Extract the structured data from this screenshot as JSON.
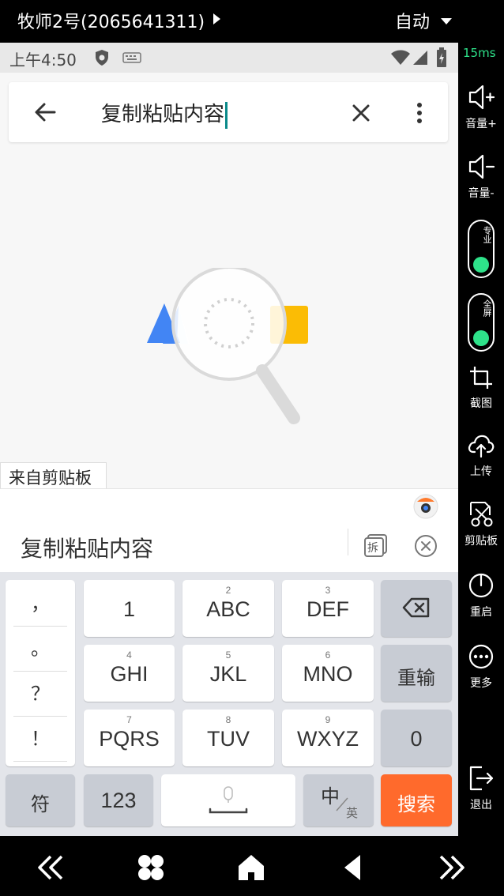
{
  "topbar": {
    "device_name": "牧师2号(2065641311)",
    "mode": "自动"
  },
  "statusbar": {
    "time": "上午4:50"
  },
  "search": {
    "query": "复制粘贴内容"
  },
  "clipboard": {
    "tab_label": "来自剪贴板",
    "content": "复制粘贴内容",
    "split_label": "拆"
  },
  "keyboard": {
    "punctuation": [
      "，",
      "。",
      "？",
      "！"
    ],
    "rows": [
      [
        {
          "main": "1",
          "sub": ""
        },
        {
          "main": "ABC",
          "sub": "2"
        },
        {
          "main": "DEF",
          "sub": "3"
        }
      ],
      [
        {
          "main": "GHI",
          "sub": "4"
        },
        {
          "main": "JKL",
          "sub": "5"
        },
        {
          "main": "MNO",
          "sub": "6"
        }
      ],
      [
        {
          "main": "PQRS",
          "sub": "7"
        },
        {
          "main": "TUV",
          "sub": "8"
        },
        {
          "main": "WXYZ",
          "sub": "9"
        }
      ]
    ],
    "reinput": "重输",
    "zero": "0",
    "symbols": "符",
    "numbers": "123",
    "lang_main": "中",
    "lang_sub": "英",
    "search": "搜索",
    "search_color": "#ff6a2c"
  },
  "sidebar": {
    "latency": "15ms",
    "volume_up": "音量+",
    "volume_down": "音量-",
    "toggle_pro": "专业",
    "toggle_full": "全屏",
    "screenshot": "截图",
    "upload": "上传",
    "clipboard": "剪贴板",
    "restart": "重启",
    "more": "更多",
    "exit": "退出",
    "accent": "#2ee28a"
  },
  "icons": [
    "back-arrow-icon",
    "clear-icon",
    "more-vert-icon",
    "mic-icon",
    "backspace-icon",
    "volume-up-icon",
    "volume-down-icon",
    "crop-icon",
    "upload-icon",
    "scissors-icon",
    "power-icon",
    "more-icon",
    "exit-icon",
    "rewind-icon",
    "apps-icon",
    "home-icon",
    "back-icon",
    "forward-icon"
  ]
}
